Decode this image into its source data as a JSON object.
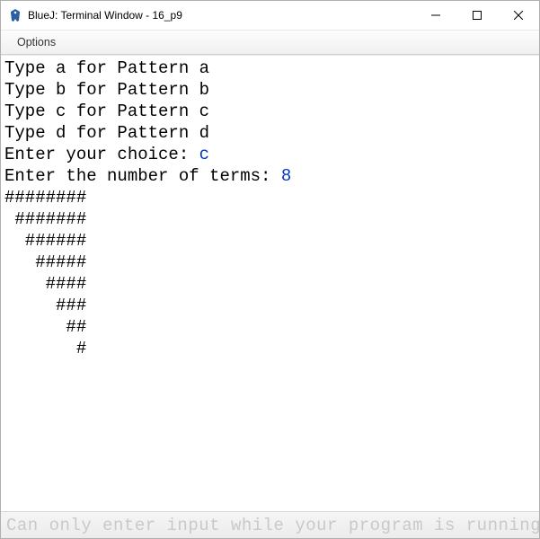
{
  "window": {
    "title": "BlueJ: Terminal Window - 16_p9"
  },
  "menubar": {
    "options": "Options"
  },
  "terminal": {
    "lines": [
      {
        "text": "Type a for Pattern a"
      },
      {
        "text": "Type b for Pattern b"
      },
      {
        "text": "Type c for Pattern c"
      },
      {
        "text": "Type d for Pattern d"
      },
      {
        "text": "Enter your choice: ",
        "input": "c"
      },
      {
        "text": "Enter the number of terms: ",
        "input": "8"
      },
      {
        "text": "########"
      },
      {
        "text": " #######"
      },
      {
        "text": "  ######"
      },
      {
        "text": "   #####"
      },
      {
        "text": "    ####"
      },
      {
        "text": "     ###"
      },
      {
        "text": "      ##"
      },
      {
        "text": "       #"
      }
    ]
  },
  "statusbar": {
    "message": "Can only enter input while your program is running"
  }
}
